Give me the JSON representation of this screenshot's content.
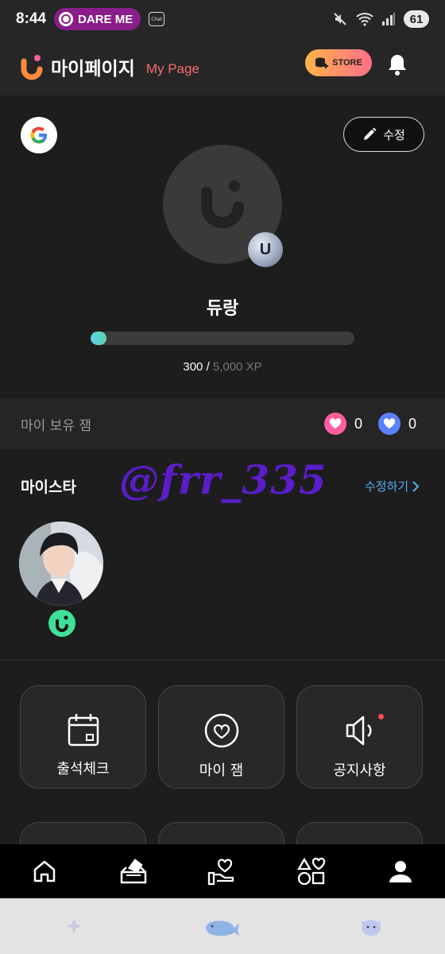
{
  "status_bar": {
    "time": "8:44",
    "notification_pill": "DARE ME",
    "chat_icon_text": "Chat",
    "battery": "61"
  },
  "header": {
    "title": "마이페이지",
    "subtitle": "My Page",
    "store_label": "STORE"
  },
  "profile": {
    "edit_label": "수정",
    "level_badge_letter": "U",
    "nickname": "듀랑",
    "xp_current": "300",
    "xp_separator": "/",
    "xp_max": "5,000 XP",
    "xp_progress_fraction": 0.06
  },
  "gems": {
    "label": "마이 보유 잼",
    "pink_count": "0",
    "blue_count": "0",
    "pink_color": "#ff5fa2",
    "blue_color": "#5a82ff"
  },
  "mystar": {
    "title": "마이스타",
    "watermark": "@frr_335",
    "edit_link": "수정하기"
  },
  "menu": [
    {
      "label": "출석체크",
      "icon": "calendar-icon"
    },
    {
      "label": "마이 잼",
      "icon": "heart-circle-icon"
    },
    {
      "label": "공지사항",
      "icon": "speaker-icon"
    }
  ],
  "bottom_nav": [
    {
      "icon": "home-icon",
      "active": false
    },
    {
      "icon": "vote-icon",
      "active": false
    },
    {
      "icon": "donate-icon",
      "active": false
    },
    {
      "icon": "shapes-icon",
      "active": false
    },
    {
      "icon": "profile-icon",
      "active": true
    }
  ],
  "colors": {
    "accent_red": "#f36b6b",
    "link_blue": "#4fb2f2",
    "watermark_purple": "#5b1dc9",
    "badge_green": "#3fe09a"
  }
}
